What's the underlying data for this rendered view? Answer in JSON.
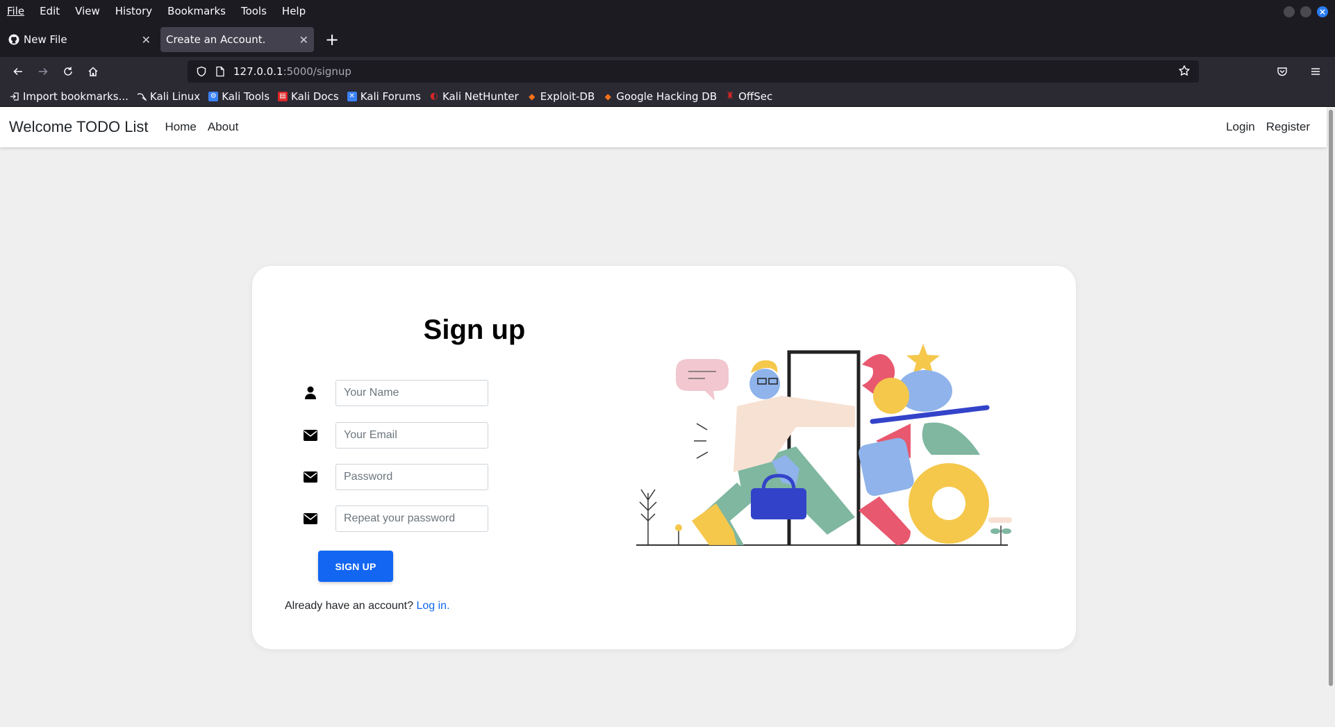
{
  "menubar": {
    "items": [
      {
        "key": "F",
        "rest": "ile"
      },
      {
        "key": "E",
        "rest": "dit"
      },
      {
        "key": "V",
        "rest": "iew"
      },
      {
        "key": "",
        "pre": "Hi",
        "key2": "s",
        "rest": "tory"
      },
      {
        "key": "B",
        "rest": "ookmarks"
      },
      {
        "key": "T",
        "rest": "ools"
      },
      {
        "key": "H",
        "rest": "elp"
      }
    ],
    "labels": [
      "File",
      "Edit",
      "View",
      "History",
      "Bookmarks",
      "Tools",
      "Help"
    ]
  },
  "tabs": [
    {
      "label": "New File",
      "icon": "github-icon",
      "active": false
    },
    {
      "label": "Create an Account.",
      "icon": "",
      "active": true
    }
  ],
  "newtab_label": "+",
  "url": {
    "host": "127.0.0.1",
    "path": ":5000/signup"
  },
  "bookmarks": [
    {
      "label": "Import bookmarks...",
      "icon": "import-icon",
      "color": "#fbfbfe"
    },
    {
      "label": "Kali Linux",
      "icon": "kali-dragon-icon",
      "color": "#ffffff"
    },
    {
      "label": "Kali Tools",
      "icon": "kali-tools-icon",
      "color": "#3b82f6"
    },
    {
      "label": "Kali Docs",
      "icon": "kali-docs-icon",
      "color": "#dc2626"
    },
    {
      "label": "Kali Forums",
      "icon": "kali-forums-icon",
      "color": "#3b82f6"
    },
    {
      "label": "Kali NetHunter",
      "icon": "nethunter-icon",
      "color": "#dc2626"
    },
    {
      "label": "Exploit-DB",
      "icon": "exploit-db-icon",
      "color": "#f97316"
    },
    {
      "label": "Google Hacking DB",
      "icon": "ghdb-icon",
      "color": "#f97316"
    },
    {
      "label": "OffSec",
      "icon": "offsec-icon",
      "color": "#dc2626"
    }
  ],
  "site": {
    "brand": "Welcome TODO List",
    "nav": [
      "Home",
      "About"
    ],
    "nav_right": [
      "Login",
      "Register"
    ]
  },
  "form": {
    "title": "Sign up",
    "fields": [
      {
        "placeholder": "Your Name",
        "icon": "user-icon"
      },
      {
        "placeholder": "Your Email",
        "icon": "envelope-icon"
      },
      {
        "placeholder": "Password",
        "icon": "envelope-icon"
      },
      {
        "placeholder": "Repeat your password",
        "icon": "envelope-icon"
      }
    ],
    "submit_label": "SIGN UP",
    "login_prompt": "Already have an account?",
    "login_link": "Log in."
  },
  "colors": {
    "accent": "#1266f1",
    "chrome_dark": "#1c1b22",
    "chrome_mid": "#2b2a33",
    "page_bg": "#efefef"
  }
}
